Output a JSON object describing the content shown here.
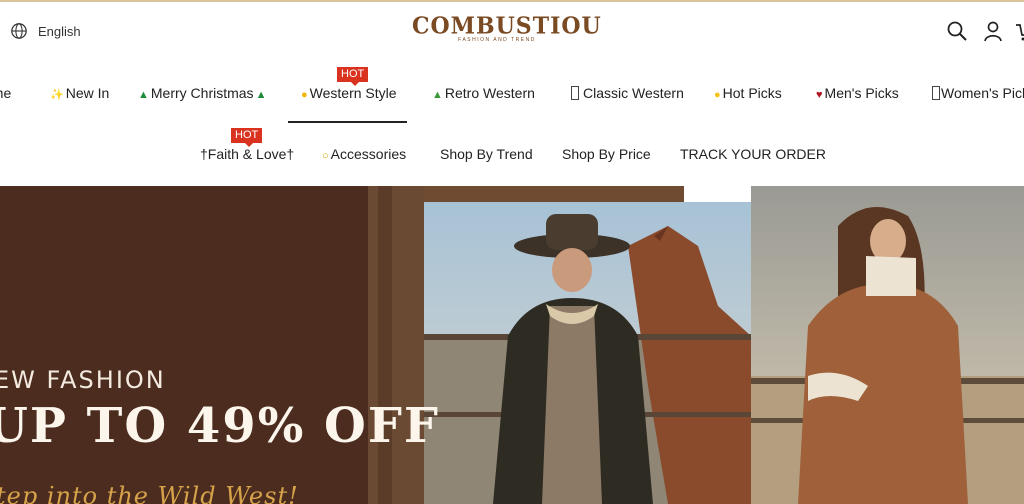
{
  "header": {
    "language_label": "English",
    "logo_text": "COMBUSTIOU",
    "logo_tagline": "FASHION AND TREND",
    "icons": [
      "globe-icon",
      "search-icon",
      "account-icon",
      "cart-icon"
    ],
    "colors": {
      "logo": "#7a4a22",
      "hot_badge": "#d9321f",
      "top_line": "#d8c39c"
    }
  },
  "nav": {
    "row1": [
      {
        "label": "ome"
      },
      {
        "label": "New In",
        "icon": "sparkle-icon"
      },
      {
        "label": "Merry Christmas",
        "icon": "tree-icon"
      },
      {
        "label": "Western Style",
        "icon": "hand-icon",
        "badge": "HOT",
        "active": true
      },
      {
        "label": "Retro Western",
        "icon": "mountain-icon"
      },
      {
        "label": "Classic Western",
        "icon": "placeholder-icon"
      },
      {
        "label": "Hot Picks",
        "icon": "sun-icon"
      },
      {
        "label": "Men's Picks",
        "icon": "heart-icon"
      },
      {
        "label": "Women's Pick",
        "icon": "placeholder-icon"
      }
    ],
    "row2": [
      {
        "label": "†Faith & Love†",
        "badge": "HOT"
      },
      {
        "label": "Accessories",
        "icon": "ring-icon"
      },
      {
        "label": "Shop By Trend"
      },
      {
        "label": "Shop By Price"
      },
      {
        "label": "TRACK YOUR ORDER"
      }
    ]
  },
  "hero": {
    "line1": "EW FASHION",
    "line2": "UP TO 49% OFF",
    "line3": "tep into the Wild West!",
    "colors": {
      "panel": "#4b2c1e",
      "script": "#d6a24a"
    }
  }
}
